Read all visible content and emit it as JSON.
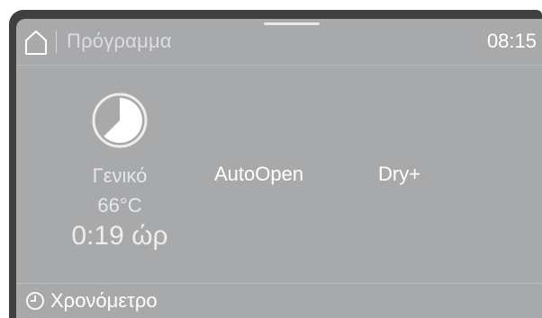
{
  "header": {
    "title": "Πρόγραμμα",
    "time": "08:15",
    "home_icon": "home-icon"
  },
  "program": {
    "icon": "program-general-icon",
    "name": "Γενικό",
    "temperature": "66°C",
    "duration": "0:19 ώρ"
  },
  "options": [
    {
      "label": "AutoOpen"
    },
    {
      "label": "Dry+"
    }
  ],
  "footer": {
    "timer_label": "Χρονόμετρο",
    "timer_icon": "clock-icon"
  },
  "colors": {
    "bezel": "#404040",
    "screen": "#a8a9ab",
    "text_primary": "#ffffff",
    "text_secondary": "#e6e7e8"
  }
}
